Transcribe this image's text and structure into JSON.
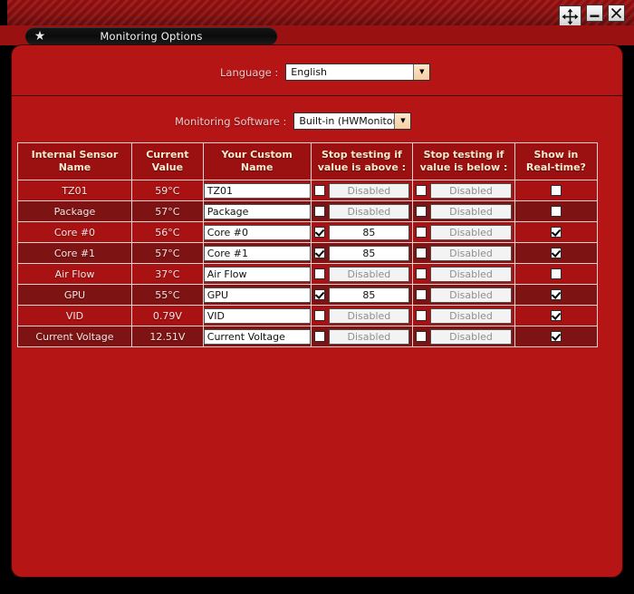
{
  "window": {
    "title_bar_buttons": [
      {
        "name": "move-resize",
        "glyph": "move-arrows-icon",
        "label": ""
      },
      {
        "name": "minimize",
        "glyph": "minimize-icon",
        "label": ""
      },
      {
        "name": "close",
        "glyph": "close-icon",
        "label": ""
      }
    ]
  },
  "tab": {
    "icon": "star-icon",
    "label": "Monitoring Options"
  },
  "settings": {
    "language": {
      "label": "Language :",
      "value": "English",
      "arrow_icon": "chevron-down-icon"
    },
    "monitoring_software": {
      "label": "Monitoring Software :",
      "value": "Built-in (HWMonitor)",
      "arrow_icon": "chevron-down-icon"
    }
  },
  "table": {
    "headers": [
      "Internal Sensor\nName",
      "Current\nValue",
      "Your Custom\nName",
      "Stop testing if\nvalue is above :",
      "Stop testing if\nvalue is below :",
      "Show in\nReal-time?"
    ],
    "headers_lines": [
      [
        "Internal Sensor",
        "Name"
      ],
      [
        "Current",
        "Value"
      ],
      [
        "Your Custom",
        "Name"
      ],
      [
        "Stop testing if",
        "value is above :"
      ],
      [
        "Stop testing if",
        "value is below :"
      ],
      [
        "Show in",
        "Real-time?"
      ]
    ],
    "disabled_placeholder": "Disabled",
    "rows": [
      {
        "sensor_name": "TZ01",
        "current_value": "59°C",
        "custom_name": "TZ01",
        "above_enabled": false,
        "above_value": "Disabled",
        "below_enabled": false,
        "below_value": "Disabled",
        "realtime": false
      },
      {
        "sensor_name": "Package",
        "current_value": "57°C",
        "custom_name": "Package",
        "above_enabled": false,
        "above_value": "Disabled",
        "below_enabled": false,
        "below_value": "Disabled",
        "realtime": false
      },
      {
        "sensor_name": "Core #0",
        "current_value": "56°C",
        "custom_name": "Core #0",
        "above_enabled": true,
        "above_value": "85",
        "below_enabled": false,
        "below_value": "Disabled",
        "realtime": true
      },
      {
        "sensor_name": "Core #1",
        "current_value": "57°C",
        "custom_name": "Core #1",
        "above_enabled": true,
        "above_value": "85",
        "below_enabled": false,
        "below_value": "Disabled",
        "realtime": true
      },
      {
        "sensor_name": "Air Flow",
        "current_value": "37°C",
        "custom_name": "Air Flow",
        "above_enabled": false,
        "above_value": "Disabled",
        "below_enabled": false,
        "below_value": "Disabled",
        "realtime": false
      },
      {
        "sensor_name": "GPU",
        "current_value": "55°C",
        "custom_name": "GPU",
        "above_enabled": true,
        "above_value": "85",
        "below_enabled": false,
        "below_value": "Disabled",
        "realtime": true
      },
      {
        "sensor_name": "VID",
        "current_value": "0.79V",
        "custom_name": "VID",
        "above_enabled": false,
        "above_value": "Disabled",
        "below_enabled": false,
        "below_value": "Disabled",
        "realtime": true
      },
      {
        "sensor_name": "Current Voltage",
        "current_value": "12.51V",
        "custom_name": "Current Voltage",
        "above_enabled": false,
        "above_value": "Disabled",
        "below_enabled": false,
        "below_value": "Disabled",
        "realtime": true
      }
    ]
  },
  "colors": {
    "panel_red": "#b51515",
    "header_red": "#9b1010",
    "row_odd": "#a81212",
    "row_even": "#7d1313",
    "label_text": "#f3c9c9",
    "header_text": "#ffe9cf",
    "grid_line": "#e9d2d2"
  }
}
